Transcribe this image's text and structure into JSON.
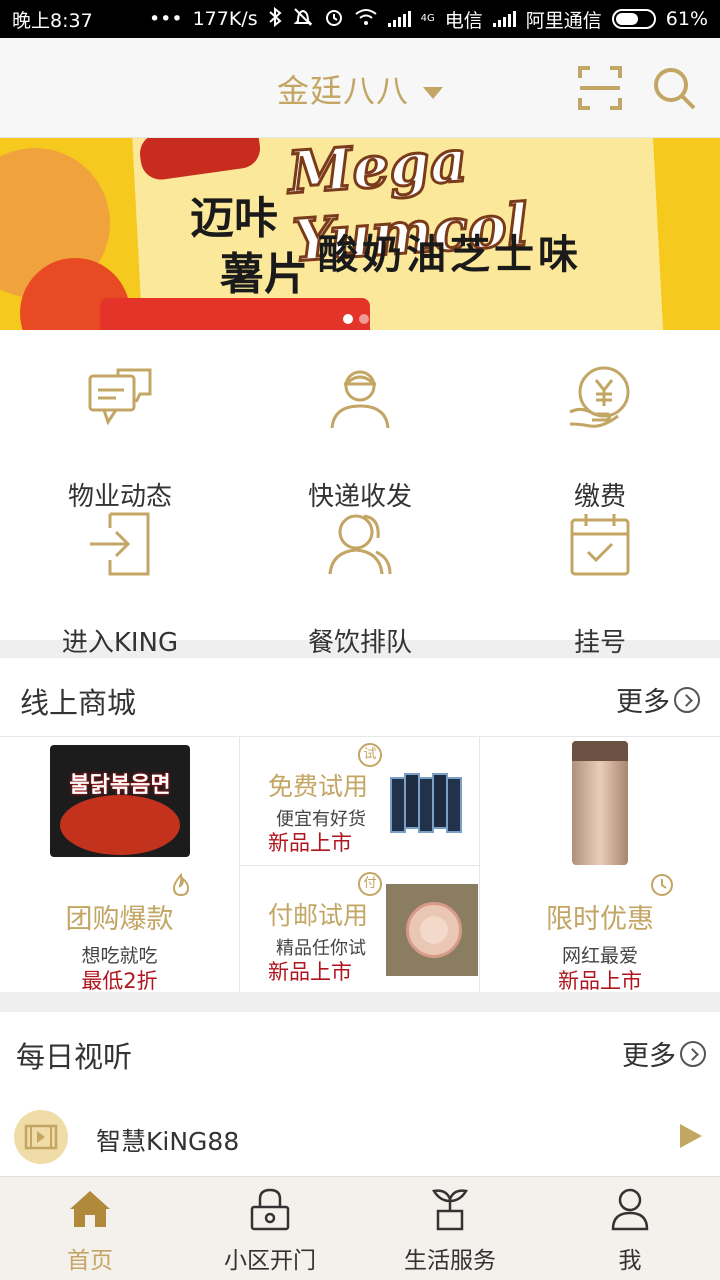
{
  "status_bar": {
    "time": "晚上8:37",
    "dots": "•••",
    "speed": "177K/s",
    "net_type": "4G",
    "carrier1": "电信",
    "carrier2": "阿里通信",
    "battery": "61%",
    "battery_level": 0.61
  },
  "header": {
    "title": "金廷八八",
    "icons": [
      "scan-icon",
      "search-icon"
    ]
  },
  "banner": {
    "brand": "Mega Yumcol",
    "line1": "迈咔",
    "line2": "薯片",
    "line3": "酸奶油芝士味",
    "pages": 2,
    "active_page": 1
  },
  "services": [
    {
      "label": "物业动态",
      "icon": "chat-bubbles-icon"
    },
    {
      "label": "快递收发",
      "icon": "courier-icon"
    },
    {
      "label": "缴费",
      "icon": "payment-icon"
    },
    {
      "label": "进入KING",
      "icon": "enter-icon"
    },
    {
      "label": "餐饮排队",
      "icon": "queue-icon"
    },
    {
      "label": "挂号",
      "icon": "calendar-check-icon"
    }
  ],
  "mall": {
    "title": "线上商城",
    "more": "更多",
    "group_buy": {
      "title": "团购爆款",
      "subtitle": "想吃就吃",
      "price": "最低2折",
      "icon": "flame-icon"
    },
    "free_trial": {
      "title": "免费试用",
      "subtitle": "便宜有好货",
      "tag": "新品上市",
      "badge": "试"
    },
    "postage_trial": {
      "title": "付邮试用",
      "subtitle": "精品任你试",
      "tag": "新品上市",
      "badge": "付"
    },
    "limited": {
      "title": "限时优惠",
      "subtitle": "网红最爱",
      "tag": "新品上市",
      "icon": "clock-icon"
    },
    "noodle_pack_text": "불닭볶음면"
  },
  "daily": {
    "title": "每日视听",
    "more": "更多",
    "item": {
      "name": "智慧KiNG88",
      "icon": "video-icon"
    }
  },
  "tabs": [
    {
      "label": "首页",
      "icon": "home-icon",
      "active": true
    },
    {
      "label": "小区开门",
      "icon": "lock-icon",
      "active": false
    },
    {
      "label": "生活服务",
      "icon": "plant-icon",
      "active": false
    },
    {
      "label": "我",
      "icon": "user-icon",
      "active": false
    }
  ],
  "colors": {
    "accent": "#c3a564",
    "price_red": "#b0151e",
    "banner_yellow": "#f5c91d"
  }
}
